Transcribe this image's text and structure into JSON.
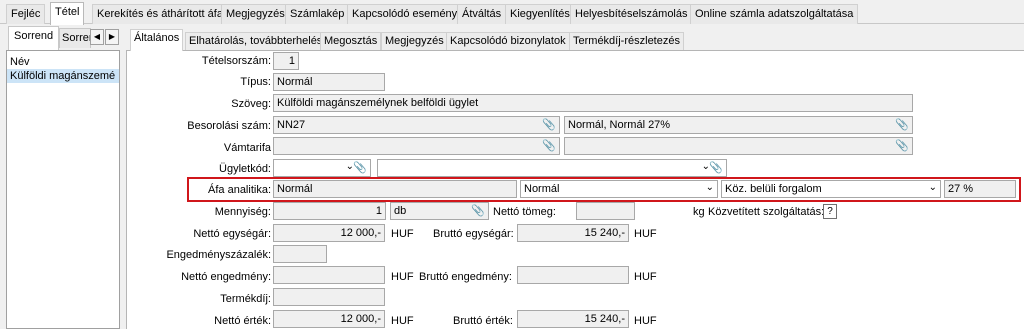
{
  "top_tabs": [
    {
      "label": "Fejléc",
      "active": false
    },
    {
      "label": "Tétel",
      "active": true
    },
    {
      "label": "Kerekítés és áthárított áfa",
      "active": false
    },
    {
      "label": "Megjegyzés",
      "active": false
    },
    {
      "label": "Számlakép",
      "active": false
    },
    {
      "label": "Kapcsolódó esemény",
      "active": false
    },
    {
      "label": "Átváltás",
      "active": false
    },
    {
      "label": "Kiegyenlítés",
      "active": false
    },
    {
      "label": "Helyesbítéselszámolás",
      "active": false
    },
    {
      "label": "Online számla adatszolgáltatása",
      "active": false
    }
  ],
  "left_tabs": [
    {
      "label": "Sorrend",
      "active": true
    },
    {
      "label": "Sorren",
      "active": false
    }
  ],
  "left_list": {
    "header": "Név",
    "items": [
      "Külföldi magánszemé"
    ]
  },
  "sub_tabs": [
    {
      "label": "Általános",
      "active": true
    },
    {
      "label": "Elhatárolás, továbbterhelés",
      "active": false
    },
    {
      "label": "Megosztás",
      "active": false
    },
    {
      "label": "Megjegyzés",
      "active": false
    },
    {
      "label": "Kapcsolódó bizonylatok",
      "active": false
    },
    {
      "label": "Termékdíj-részletezés",
      "active": false
    }
  ],
  "form": {
    "tetelsorszam": {
      "label": "Tételsorszám:",
      "value": "1"
    },
    "tipus": {
      "label": "Típus:",
      "value": "Normál"
    },
    "szoveg": {
      "label": "Szöveg:",
      "value": "Külföldi magánszemélynek belföldi ügylet"
    },
    "besorolasi_szam": {
      "label": "Besorolási szám:",
      "value": "NN27",
      "desc": "Normál, Normál 27%"
    },
    "vamtarifa": {
      "label": "Vámtarifa",
      "value": "",
      "desc": ""
    },
    "ugyletkod": {
      "label": "Ügyletkód:",
      "value": "",
      "desc": ""
    },
    "afa_analitika": {
      "label": "Áfa analitika:",
      "value": "Normál",
      "select1": "Normál",
      "select2": "Köz. belüli forgalom",
      "rate": "27 %"
    },
    "mennyiseg": {
      "label": "Mennyiség:",
      "value": "1",
      "unit": "db"
    },
    "netto_tomeg": {
      "label": "Nettó tömeg:",
      "value": "",
      "unit": "kg"
    },
    "kozvetitett": {
      "label": "Közvetített szolgáltatás:",
      "value": "?"
    },
    "netto_egysegar": {
      "label": "Nettó egységár:",
      "value": "12 000,-",
      "currency": "HUF"
    },
    "brutto_egysegar": {
      "label": "Bruttó egységár:",
      "value": "15 240,-",
      "currency": "HUF"
    },
    "engedmenyszazalek": {
      "label": "Engedményszázalék:",
      "value": ""
    },
    "netto_engedmeny": {
      "label": "Nettó engedmény:",
      "value": "",
      "currency": "HUF"
    },
    "brutto_engedmeny": {
      "label": "Bruttó engedmény:",
      "value": "",
      "currency": "HUF"
    },
    "termekdij": {
      "label": "Termékdíj:",
      "value": ""
    },
    "netto_ertek": {
      "label": "Nettó érték:",
      "value": "12 000,-",
      "currency": "HUF"
    },
    "brutto_ertek": {
      "label": "Bruttó érték:",
      "value": "15 240,-",
      "currency": "HUF"
    }
  },
  "colors": {
    "highlight": "#d0161b",
    "selection": "#cce4f7"
  }
}
